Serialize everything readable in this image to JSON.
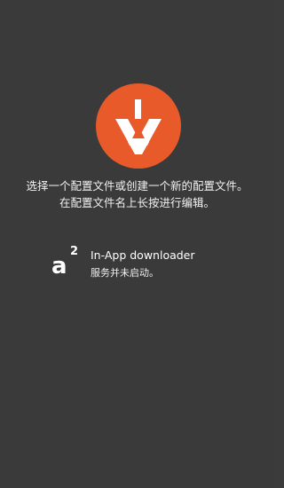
{
  "colors": {
    "background": "#3a3a3a",
    "accent": "#e85a2a"
  },
  "logo": {
    "icon": "openvpn-style-logo-icon"
  },
  "message": {
    "line1": "选择一个配置文件或创建一个新的配置文件。",
    "line2": "在配置文件名上长按进行编辑。"
  },
  "downloader": {
    "icon_letter": "a",
    "icon_superscript": "2",
    "title": "In-App downloader",
    "status": "服务并未启动。"
  }
}
